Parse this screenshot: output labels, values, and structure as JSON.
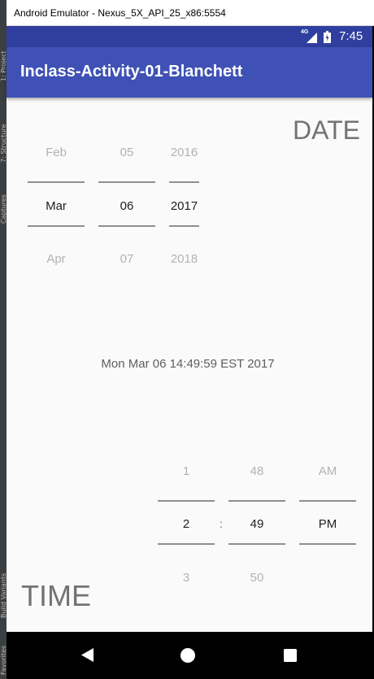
{
  "window": {
    "title": "Android Emulator - Nexus_5X_API_25_x86:5554"
  },
  "ide_tabs": [
    "1: Project",
    "7: Structure",
    "Captures",
    "Build Variants",
    "Favorites"
  ],
  "status_bar": {
    "network": "4G",
    "time": "7:45",
    "signal_icon": "signal-icon",
    "battery_icon": "battery-icon"
  },
  "app_bar": {
    "title": "Inclass-Activity-01-Blanchett"
  },
  "date_picker": {
    "label": "DATE",
    "month": {
      "prev": "Feb",
      "current": "Mar",
      "next": "Apr"
    },
    "day": {
      "prev": "05",
      "current": "06",
      "next": "07"
    },
    "year": {
      "prev": "2016",
      "current": "2017",
      "next": "2018"
    }
  },
  "datetime_text": "Mon Mar 06 14:49:59 EST 2017",
  "time_picker": {
    "label": "TIME",
    "separator": ":",
    "hour": {
      "prev": "1",
      "current": "2",
      "next": "3"
    },
    "minute": {
      "prev": "48",
      "current": "49",
      "next": "50"
    },
    "ampm": {
      "prev": "AM",
      "current": "PM"
    }
  },
  "nav_bar": {
    "back_icon": "back-triangle-icon",
    "home_icon": "home-circle-icon",
    "recents_icon": "recents-square-icon"
  }
}
